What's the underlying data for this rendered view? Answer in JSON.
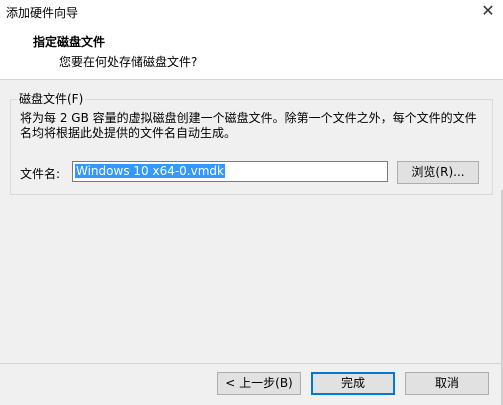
{
  "window": {
    "title": "添加硬件向导",
    "close_glyph": "✕"
  },
  "header": {
    "title": "指定磁盘文件",
    "subtitle": "您要在何处存储磁盘文件?"
  },
  "group": {
    "legend": "磁盘文件(F)",
    "description": "将为每 2 GB 容量的虚拟磁盘创建一个磁盘文件。除第一个文件之外，每个文件的文件名均将根据此处提供的文件名自动生成。"
  },
  "file": {
    "label": "文件名:",
    "value": "Windows 10 x64-0.vmdk",
    "browse_label": "浏览(R)..."
  },
  "footer": {
    "back_label": "< 上一步(B)",
    "finish_label": "完成",
    "cancel_label": "取消"
  },
  "colors": {
    "selection": "#3399ff",
    "focus_border": "#0078d7"
  }
}
